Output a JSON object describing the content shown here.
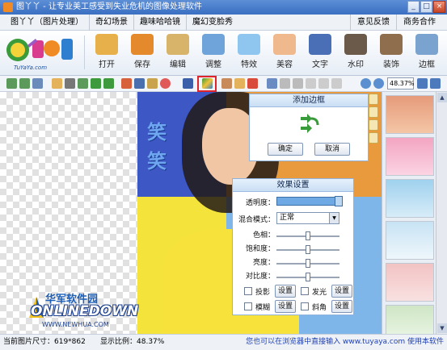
{
  "window": {
    "title": "图丫丫 - 让专业美工感受到失业危机的图像处理软件",
    "controls": [
      "_",
      "□",
      "×"
    ]
  },
  "menu": {
    "left": [
      "图丫丫（图片处理）",
      "奇幻场景",
      "趣味哈哈镜",
      "魔幻变脸秀"
    ],
    "right": [
      "意见反馈",
      "商务合作"
    ]
  },
  "logo": {
    "url_text": "TuYaYa.com"
  },
  "toolbar": {
    "tools": [
      {
        "label": "打开",
        "icon": "folder-open-icon",
        "color": "#e8b04a"
      },
      {
        "label": "保存",
        "icon": "save-icon",
        "color": "#e58a2c"
      },
      {
        "label": "编辑",
        "icon": "edit-icon",
        "color": "#d8b36a"
      },
      {
        "label": "调整",
        "icon": "adjust-icon",
        "color": "#6ea4d9"
      },
      {
        "label": "特效",
        "icon": "effects-icon",
        "color": "#8fc6f0"
      },
      {
        "label": "美容",
        "icon": "beauty-icon",
        "color": "#f0b98d"
      },
      {
        "label": "文字",
        "icon": "text-icon",
        "color": "#4b6fb6"
      },
      {
        "label": "水印",
        "icon": "watermark-icon",
        "color": "#6b5a4a"
      },
      {
        "label": "装饰",
        "icon": "decorate-icon",
        "color": "#8e6e4c"
      },
      {
        "label": "边框",
        "icon": "frame-icon",
        "color": "#7aa3cf"
      }
    ]
  },
  "zoom": {
    "value": "48.37%"
  },
  "canvas": {
    "art_text": "笑笑"
  },
  "dialog_frame": {
    "title": "添加边框",
    "ok": "确定",
    "cancel": "取消"
  },
  "dialog_effects": {
    "title": "效果设置",
    "opacity_label": "透明度：",
    "blend_label": "混合模式：",
    "blend_value": "正常",
    "hue_label": "色相：",
    "saturation_label": "饱和度：",
    "brightness_label": "亮度：",
    "contrast_label": "对比度：",
    "shadow_label": "投影",
    "glow_label": "发光",
    "blur_label": "模糊",
    "bevel_label": "斜角",
    "settings_label": "设置"
  },
  "watermark": {
    "brand": "华军软件园",
    "name": "ONLINEDOWN",
    "url": "WWW.NEWHUA.COM"
  },
  "status": {
    "size_label": "当前图片尺寸：619*862",
    "ratio_label": "显示比例：48.37%",
    "browser_tip": "您也可以在浏览器中直接输入 www.tuyaya.com 使用本软件"
  },
  "colors": {
    "title_bar": "#3a6fc2",
    "highlight": "#e0242c",
    "link": "#1d3fb7"
  }
}
